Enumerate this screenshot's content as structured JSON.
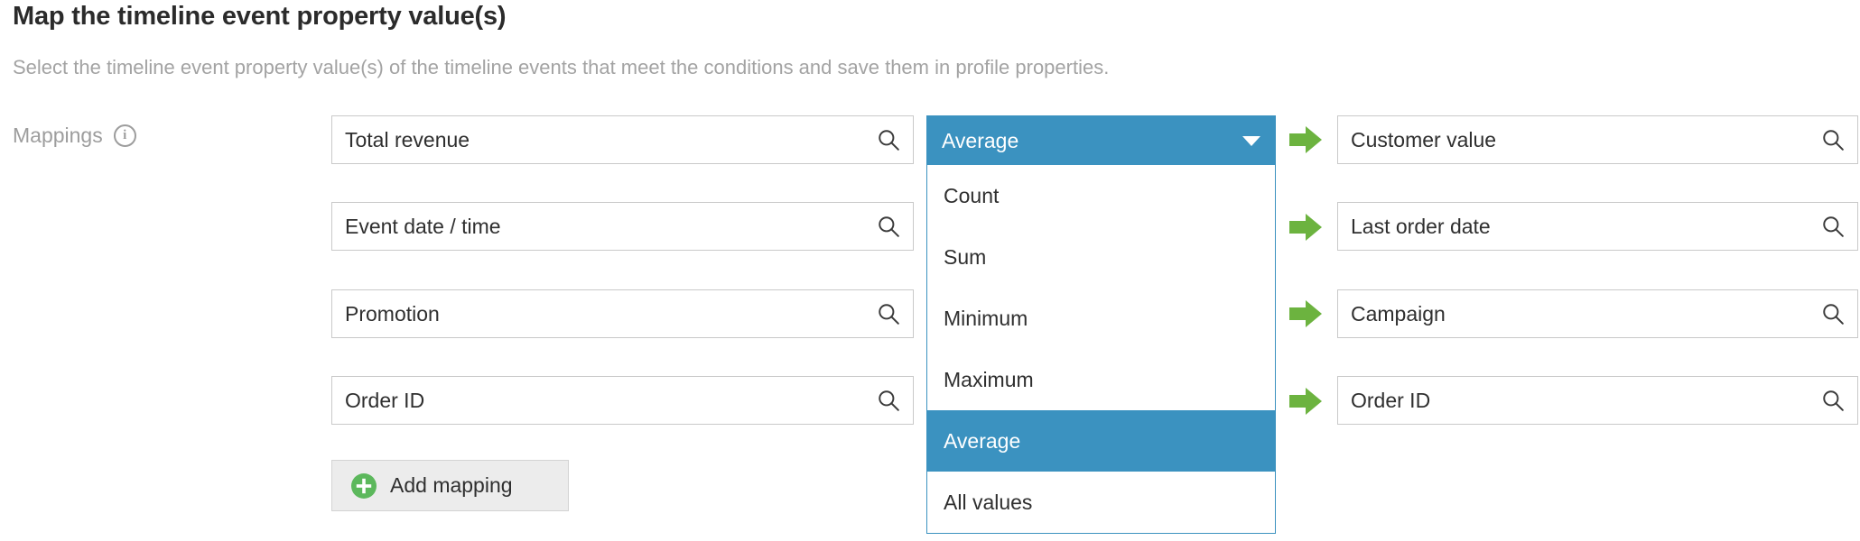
{
  "header": {
    "title": "Map the timeline event property value(s)",
    "subtitle": "Select the timeline event property value(s) of the timeline events that meet the conditions and save them in profile properties."
  },
  "mappings_section": {
    "label": "Mappings",
    "info_icon": "info-icon",
    "add_mapping": {
      "label": "Add mapping",
      "icon": "plus-circle-icon"
    },
    "rows": [
      {
        "source": "Total revenue",
        "source_icon": "search-icon",
        "arrow_icon": "green-arrow-icon",
        "target": "Customer value",
        "target_icon": "search-icon"
      },
      {
        "source": "Event date / time",
        "source_icon": "search-icon",
        "arrow_icon": "green-arrow-icon",
        "target": "Last order date",
        "target_icon": "search-icon"
      },
      {
        "source": "Promotion",
        "source_icon": "search-icon",
        "arrow_icon": "green-arrow-icon",
        "target": "Campaign",
        "target_icon": "search-icon"
      },
      {
        "source": "Order ID",
        "source_icon": "search-icon",
        "arrow_icon": "green-arrow-icon",
        "target": "Order ID",
        "target_icon": "search-icon"
      }
    ]
  },
  "dropdown": {
    "selected_value": "Average",
    "caret_icon": "chevron-down-icon",
    "expanded": true,
    "options": [
      {
        "label": "Count",
        "selected": false
      },
      {
        "label": "Sum",
        "selected": false
      },
      {
        "label": "Minimum",
        "selected": false
      },
      {
        "label": "Maximum",
        "selected": false
      },
      {
        "label": "Average",
        "selected": true
      },
      {
        "label": "All values",
        "selected": false
      }
    ]
  },
  "colors": {
    "accent_blue": "#3b92c0",
    "arrow_green": "#6cb33f",
    "plus_green": "#5cb85c",
    "border_gray": "#c9c9c9",
    "muted_text": "#a3a3a3",
    "button_gray": "#ececec"
  }
}
